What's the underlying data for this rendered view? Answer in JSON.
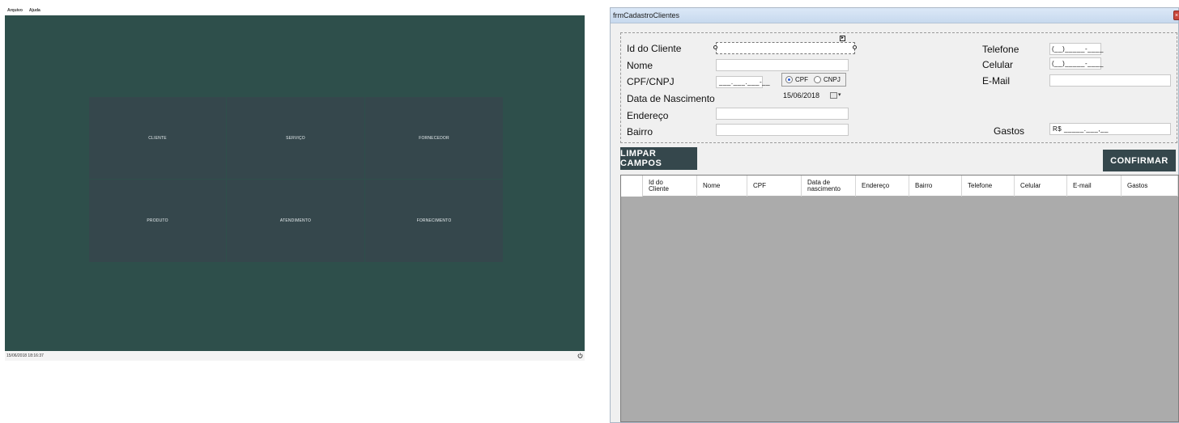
{
  "left_app": {
    "menu": [
      "Arquivo",
      "Ajuda"
    ],
    "tiles": [
      "CLIENTE",
      "SERVIÇO",
      "FORNECEDOR",
      "PRODUTO",
      "ATENDIMENTO",
      "FORNECIMENTO"
    ],
    "status": {
      "datetime": "15/06/2018 18:16:37",
      "power_icon": "power-icon"
    },
    "colors": {
      "panel": "#2e4f4b",
      "tile": "#35474c"
    }
  },
  "form": {
    "title": "frmCadastroClientes",
    "close_icon": "×",
    "fields": {
      "id_label": "Id do Cliente",
      "nome_label": "Nome",
      "cpf_label": "CPF/CNPJ",
      "cpf_mask": "___.___.___-__",
      "doc_type": {
        "options": [
          "CPF",
          "CNPJ"
        ],
        "selected": "CPF"
      },
      "nascimento_label": "Data de Nascimento",
      "nascimento_value": "15/06/2018",
      "endereco_label": "Endereço",
      "bairro_label": "Bairro",
      "telefone_label": "Telefone",
      "telefone_mask": "(__)_____-____",
      "celular_label": "Celular",
      "celular_mask": "(__)_____-____",
      "email_label": "E-Mail",
      "gastos_label": "Gastos",
      "gastos_mask": "R$ _____.___,__"
    },
    "buttons": {
      "clear": "LIMPAR CAMPOS",
      "confirm": "CONFIRMAR"
    },
    "grid": {
      "columns": [
        "Id do\nCliente",
        "Nome",
        "CPF",
        "Data de\nnascimento",
        "Endereço",
        "Bairro",
        "Telefone",
        "Celular",
        "E-mail",
        "Gastos"
      ]
    },
    "colors": {
      "button": "#35474c",
      "grid_bg": "#ababab"
    }
  }
}
